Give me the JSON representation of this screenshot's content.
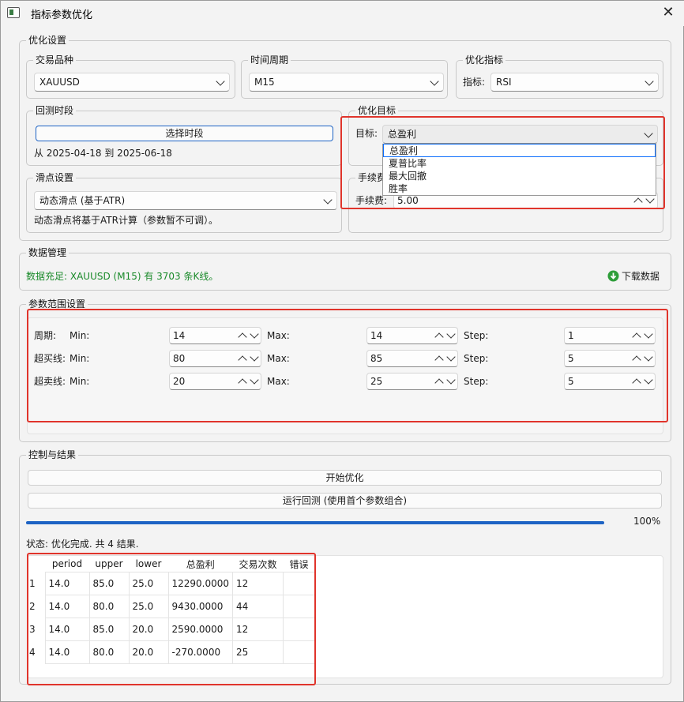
{
  "window": {
    "title": "指标参数优化",
    "close_label": "✕"
  },
  "opt_settings": {
    "legend": "优化设置",
    "symbol": {
      "legend": "交易品种",
      "value": "XAUUSD"
    },
    "period": {
      "legend": "时间周期",
      "value": "M15"
    },
    "indicator": {
      "legend": "优化指标",
      "prefix": "指标:",
      "value": "RSI"
    },
    "backtest": {
      "legend": "回测时段",
      "select_label": "选择时段",
      "range_text": "从 2025-04-18 到 2025-06-18"
    },
    "target": {
      "legend": "优化目标",
      "prefix": "目标:",
      "value": "总盈利",
      "options": [
        "总盈利",
        "夏普比率",
        "最大回撤",
        "胜率"
      ]
    },
    "slippage": {
      "legend": "滑点设置",
      "value": "动态滑点 (基于ATR)",
      "note": "动态滑点将基于ATR计算（参数暂不可调）。"
    },
    "fee": {
      "legend": "手续费",
      "prefix": "手续费:",
      "value": "5.00"
    }
  },
  "data_mgmt": {
    "legend": "数据管理",
    "status": "数据充足: XAUUSD (M15) 有 3703 条K线。",
    "status_color": "#1a8a2a",
    "download_label": "下载数据"
  },
  "params": {
    "legend": "参数范围设置",
    "min_label": "Min:",
    "max_label": "Max:",
    "step_label": "Step:",
    "rows": [
      {
        "name": "周期:",
        "min": "14",
        "max": "14",
        "step": "1"
      },
      {
        "name": "超买线:",
        "min": "80",
        "max": "85",
        "step": "5"
      },
      {
        "name": "超卖线:",
        "min": "20",
        "max": "25",
        "step": "5"
      }
    ]
  },
  "control": {
    "legend": "控制与结果",
    "start_label": "开始优化",
    "run_label": "运行回测 (使用首个参数组合)",
    "progress": 1.0,
    "progress_text": "100%",
    "status": "状态: 优化完成. 共 4 结果."
  },
  "results": {
    "headers": [
      "period",
      "upper",
      "lower",
      "总盈利",
      "交易次数",
      "错误"
    ],
    "rows": [
      {
        "idx": "1",
        "cells": [
          "14.0",
          "85.0",
          "25.0",
          "12290.0000",
          "12",
          ""
        ]
      },
      {
        "idx": "2",
        "cells": [
          "14.0",
          "80.0",
          "25.0",
          "9430.0000",
          "44",
          ""
        ]
      },
      {
        "idx": "3",
        "cells": [
          "14.0",
          "85.0",
          "20.0",
          "2590.0000",
          "12",
          ""
        ]
      },
      {
        "idx": "4",
        "cells": [
          "14.0",
          "80.0",
          "20.0",
          "-270.0000",
          "25",
          ""
        ]
      }
    ]
  },
  "colors": {
    "highlight": "#e0342b",
    "accent": "#1d63c4",
    "background": "#f3f3f3"
  }
}
